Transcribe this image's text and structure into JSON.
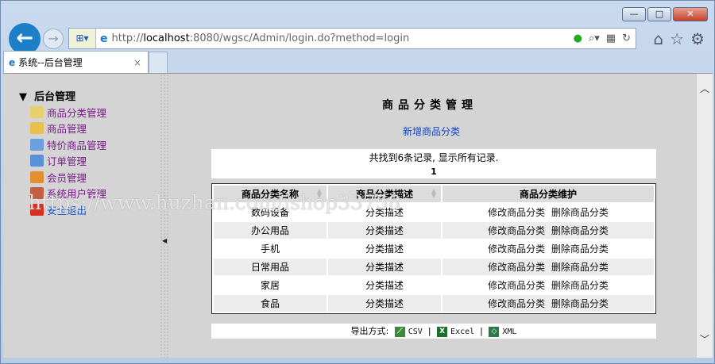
{
  "browser": {
    "url_prefix": "http://",
    "url_host": "localhost",
    "url_rest": ":8080/wgsc/Admin/login.do?method=login",
    "tab_title": "系统--后台管理",
    "tab_close": "×"
  },
  "sidebar": {
    "title": "后台管理",
    "items": [
      {
        "label": "商品分类管理",
        "icon": "edit-icon",
        "color": "#e8d070"
      },
      {
        "label": "商品管理",
        "icon": "folder-icon",
        "color": "#e8c050"
      },
      {
        "label": "特价商品管理",
        "icon": "folder-image-icon",
        "color": "#6aa0e0"
      },
      {
        "label": "订单管理",
        "icon": "list-icon",
        "color": "#5a90d8"
      },
      {
        "label": "会员管理",
        "icon": "users-icon",
        "color": "#e09030"
      },
      {
        "label": "系统用户管理",
        "icon": "user-icon",
        "color": "#c06040"
      },
      {
        "label": "安全退出",
        "icon": "exit-icon",
        "color": "#d83020"
      }
    ]
  },
  "watermark": "https://www.huzhan.com/ishop33758",
  "main": {
    "title": "商品分类管理",
    "add_link": "新增商品分类",
    "summary": "共找到6条记录, 显示所有记录.",
    "page": "1",
    "columns": [
      "商品分类名称",
      "商品分类描述",
      "商品分类维护"
    ],
    "rows": [
      {
        "name": "数码设备",
        "desc": "分类描述",
        "edit": "修改商品分类",
        "del": "删除商品分类"
      },
      {
        "name": "办公用品",
        "desc": "分类描述",
        "edit": "修改商品分类",
        "del": "删除商品分类"
      },
      {
        "name": "手机",
        "desc": "分类描述",
        "edit": "修改商品分类",
        "del": "删除商品分类"
      },
      {
        "name": "日常用品",
        "desc": "分类描述",
        "edit": "修改商品分类",
        "del": "删除商品分类"
      },
      {
        "name": "家居",
        "desc": "分类描述",
        "edit": "修改商品分类",
        "del": "删除商品分类"
      },
      {
        "name": "食品",
        "desc": "分类描述",
        "edit": "修改商品分类",
        "del": "删除商品分类"
      }
    ],
    "export_label": "导出方式:",
    "exports": [
      "CSV",
      "Excel",
      "XML"
    ],
    "sep": "|"
  }
}
